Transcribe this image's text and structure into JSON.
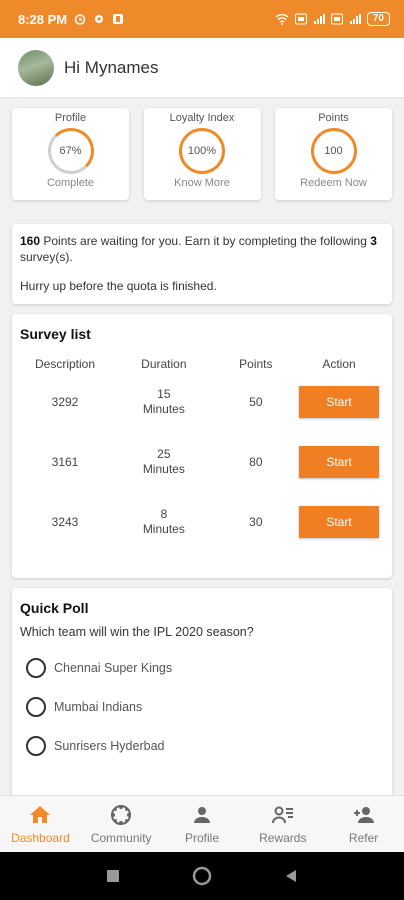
{
  "status_bar": {
    "time": "8:28 PM",
    "battery": "70",
    "left_icons": [
      "alarm-icon",
      "settings-icon",
      "app-icon"
    ],
    "right_icons": [
      "wifi-icon",
      "hd-icon",
      "signal-icon",
      "signal-icon"
    ]
  },
  "header": {
    "greeting": "Hi Mynames"
  },
  "stats": [
    {
      "title": "Profile",
      "value": "67%",
      "sub": "Complete"
    },
    {
      "title": "Loyalty Index",
      "value": "100%",
      "sub": "Know More"
    },
    {
      "title": "Points",
      "value": "100",
      "sub": "Redeem Now"
    }
  ],
  "info": {
    "points": "160",
    "text1": " Points are waiting for you. Earn it by completing the following ",
    "surveys": "3",
    "text2": " survey(s).",
    "hurry": "Hurry up before the quota is finished."
  },
  "survey_list": {
    "title": "Survey list",
    "headers": {
      "description": "Description",
      "duration": "Duration",
      "points": "Points",
      "action": "Action"
    },
    "rows": [
      {
        "description": "3292",
        "duration_num": "15",
        "duration_unit": "Minutes",
        "points": "50",
        "action": "Start"
      },
      {
        "description": "3161",
        "duration_num": "25",
        "duration_unit": "Minutes",
        "points": "80",
        "action": "Start"
      },
      {
        "description": "3243",
        "duration_num": "8",
        "duration_unit": "Minutes",
        "points": "30",
        "action": "Start"
      }
    ]
  },
  "poll": {
    "title": "Quick Poll",
    "question": "Which team will win the IPL 2020 season?",
    "options": [
      "Chennai Super Kings",
      "Mumbai Indians",
      "Sunrisers Hyderbad"
    ]
  },
  "bottom_nav": [
    {
      "label": "Dashboard",
      "icon": "home-icon",
      "active": true
    },
    {
      "label": "Community",
      "icon": "community-icon",
      "active": false
    },
    {
      "label": "Profile",
      "icon": "person-icon",
      "active": false
    },
    {
      "label": "Rewards",
      "icon": "rewards-icon",
      "active": false
    },
    {
      "label": "Refer",
      "icon": "add-person-icon",
      "active": false
    }
  ],
  "colors": {
    "accent": "#ef8a2a",
    "button": "#ef7f22"
  }
}
